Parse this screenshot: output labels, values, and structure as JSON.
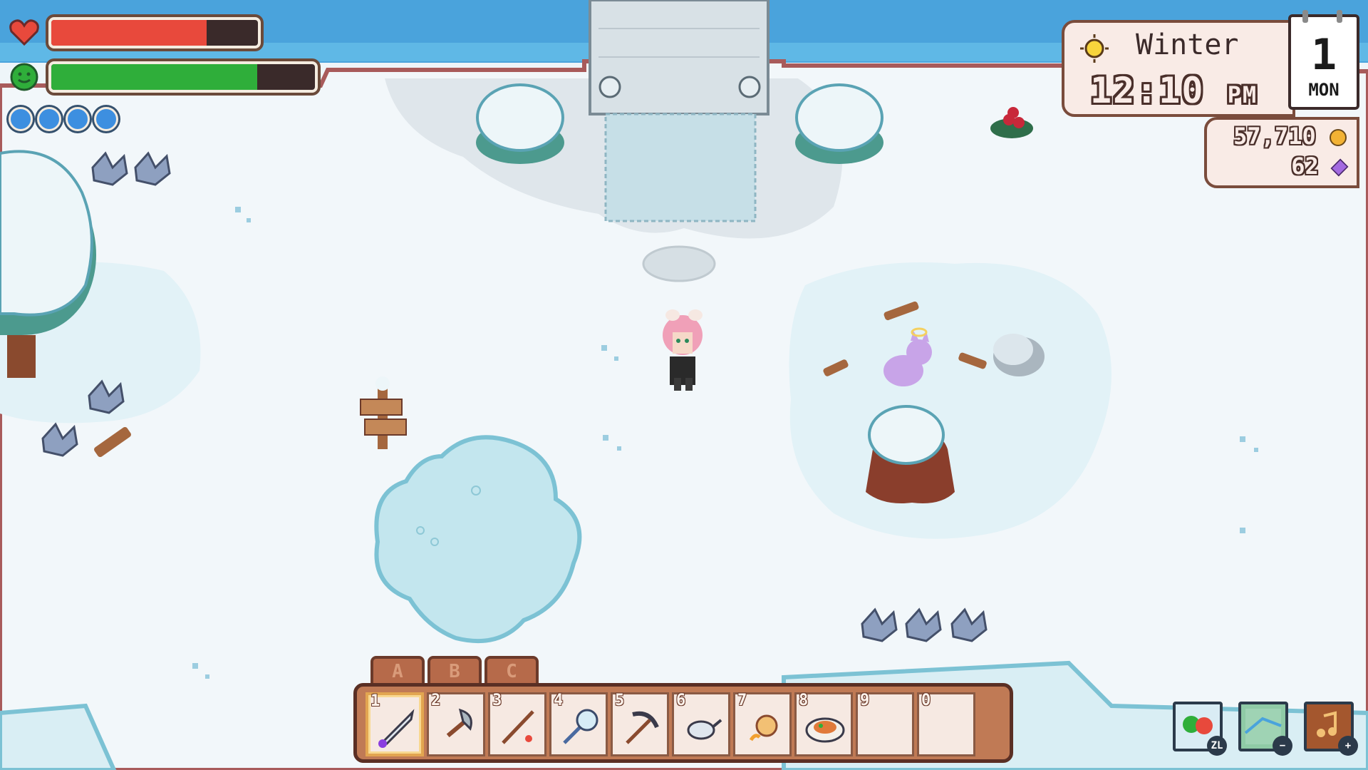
{
  "hud": {
    "health": {
      "fraction": 0.75,
      "color": "#e8493c"
    },
    "stamina": {
      "fraction": 0.78,
      "color": "#2fae3a"
    },
    "mana_orbs": 4
  },
  "calendar": {
    "season": "Winter",
    "time": "12:10",
    "ampm": "PM",
    "day": "1",
    "weekday": "MON"
  },
  "currency": {
    "gold": "57,710",
    "essence": "62"
  },
  "hotbar": {
    "tabs": [
      "A",
      "B",
      "C"
    ],
    "selected_index": 0,
    "slots": [
      {
        "number": "1",
        "icon": "sword-icon"
      },
      {
        "number": "2",
        "icon": "axe-icon"
      },
      {
        "number": "3",
        "icon": "fishing-rod-icon"
      },
      {
        "number": "4",
        "icon": "bug-net-icon"
      },
      {
        "number": "5",
        "icon": "pickaxe-icon"
      },
      {
        "number": "6",
        "icon": "watering-can-icon"
      },
      {
        "number": "7",
        "icon": "bait-icon"
      },
      {
        "number": "8",
        "icon": "meal-dish-icon"
      },
      {
        "number": "9",
        "icon": ""
      },
      {
        "number": "0",
        "icon": ""
      }
    ]
  },
  "corner_buttons": {
    "inventory_badge": "ZL",
    "map_badge": "−",
    "journal_badge": "+"
  },
  "colors": {
    "snow": "#eef5f9",
    "water": "#4aa3dc",
    "ice": "#bde3ee",
    "panel": "#f9ebe6",
    "panel_border": "#7a4c3c"
  }
}
